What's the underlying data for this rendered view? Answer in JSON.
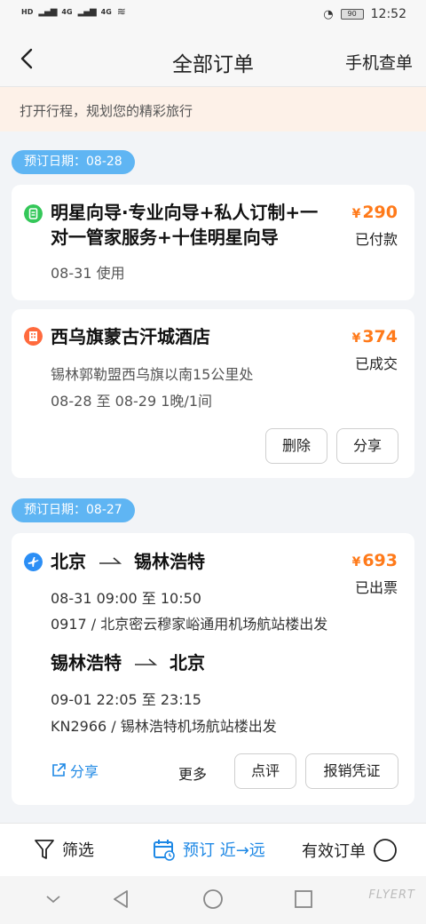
{
  "status_bar": {
    "left_items": [
      "HD",
      "4G",
      "4G"
    ],
    "battery": "90",
    "time": "12:52"
  },
  "header": {
    "title": "全部订单",
    "right_action": "手机查单"
  },
  "banner": {
    "text": "打开行程，规划您的精彩旅行"
  },
  "groups": [
    {
      "date_label": "预订日期：08-28",
      "orders": [
        {
          "icon": "guide-icon",
          "title_lines": [
            "明星向导·专业向导+私人订制+一",
            "对一管家服务+十佳明星向导"
          ],
          "price_symbol": "¥",
          "price": "290",
          "status": "已付款",
          "details": [
            "08-31 使用"
          ]
        },
        {
          "icon": "hotel-icon",
          "title_lines": [
            "西乌旗蒙古汗城酒店"
          ],
          "price_symbol": "¥",
          "price": "374",
          "status": "已成交",
          "details": [
            "锡林郭勒盟西乌旗以南15公里处",
            "08-28 至 08-29  1晚/1间"
          ],
          "buttons": [
            "删除",
            "分享"
          ]
        }
      ]
    },
    {
      "date_label": "预订日期：08-27",
      "orders": [
        {
          "icon": "flight-icon",
          "price_symbol": "¥",
          "price": "693",
          "status": "已出票",
          "legs": [
            {
              "from": "北京",
              "to": "锡林浩特",
              "time": "08-31 09:00 至 10:50",
              "info": "0917 / 北京密云穆家峪通用机场航站楼出发"
            },
            {
              "from": "锡林浩特",
              "to": "北京",
              "time": "09-01 22:05 至 23:15",
              "info": "KN2966 / 锡林浩特机场航站楼出发"
            }
          ],
          "share_label": "分享",
          "buttons": [
            "更多",
            "点评",
            "报销凭证"
          ]
        }
      ]
    }
  ],
  "bottom_bar": {
    "filter": "筛选",
    "sort": "预订 近→远",
    "valid_orders": "有效订单"
  },
  "watermark": "FLYERT",
  "colors": {
    "accent_blue": "#5fb5f3",
    "price_orange": "#ff7a1a",
    "guide_green": "#34c759",
    "hotel_orange": "#ff6a3d",
    "flight_blue": "#2b8ef5"
  }
}
